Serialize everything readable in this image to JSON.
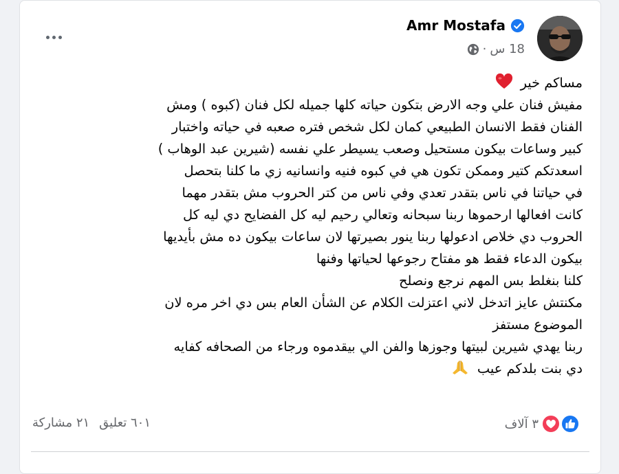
{
  "post": {
    "author": "Amr Mostafa",
    "time": "18 س",
    "separator": "·",
    "lines": [
      "مساكم خير",
      "مفيش فنان علي وجه الارض بتكون حياته كلها جميله لكل فنان (كبوه ) ومش",
      "الفنان فقط الانسان الطبيعي كمان لكل شخص فتره صعبه في حياته واختبار",
      "كبير وساعات بيكون مستحيل وصعب يسيطر علي نفسه (شيرين عبد الوهاب )",
      "اسعدتكم كتير وممكن تكون هي في كبوه فنيه   وانسانيه زي ما كلنا بتحصل",
      "في حياتنا في ناس بتقدر تعدي وفي ناس من كتر الحروب مش بتقدر  مهما",
      "كانت افعالها ارحموها ربنا سبحانه وتعالي رحيم ليه كل الفضايح دي ليه كل",
      "الحروب دي خلاص ادعولها ربنا ينور بصيرتها لان ساعات بيكون ده مش بأيديها",
      "بيكون الدعاء فقط هو مفتاح رجوعها لحياتها وفنها",
      "كلنا بنغلط بس المهم نرجع ونصلح",
      "مكنتش عايز اتدخل لاني اعتزلت الكلام عن الشأن العام بس دي اخر مره لان",
      "الموضوع مستفز",
      "ربنا يهدي شيرين لبيتها وجوزها  والفن الي بيقدموه ورجاء من الصحافه كفايه",
      "دي بنت بلدكم عيب"
    ],
    "reactions_count": "٣ آلاف",
    "comments": "٦٠١ تعليق",
    "shares": "٢١ مشاركة"
  },
  "icons": {
    "more": "more-options-icon",
    "verified": "verified-badge-icon",
    "globe": "globe-icon",
    "heart": "heart-emoji-icon",
    "pray": "praying-hands-emoji-icon",
    "like": "like-reaction-icon",
    "love": "love-reaction-icon"
  },
  "colors": {
    "accent": "#1877f2",
    "love": "#f33e58",
    "text": "#050505",
    "secondary": "#65676b"
  }
}
